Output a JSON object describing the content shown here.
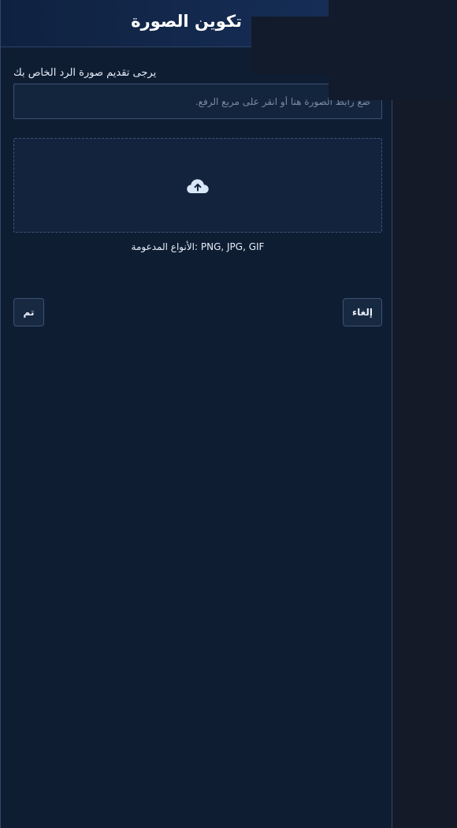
{
  "header": {
    "title": "تكوين الصورة"
  },
  "form": {
    "url_label": "يرجى تقديم صورة الرد الخاص بك",
    "url_placeholder": "ضع رابط الصورة هنا أو انقر على مربع الرفع.",
    "url_value": "",
    "upload_icon": "cloud-upload-icon",
    "supported_types": "الأنواع المدعومة: PNG, JPG, GIF"
  },
  "actions": {
    "done_label": "تم",
    "cancel_label": "إلغاء"
  },
  "colors": {
    "background": "#0f1d33",
    "header_gradient_start": "#0f2140",
    "header_gradient_end": "#17305a",
    "border": "#3b5273",
    "icon": "#d9e6f8"
  }
}
